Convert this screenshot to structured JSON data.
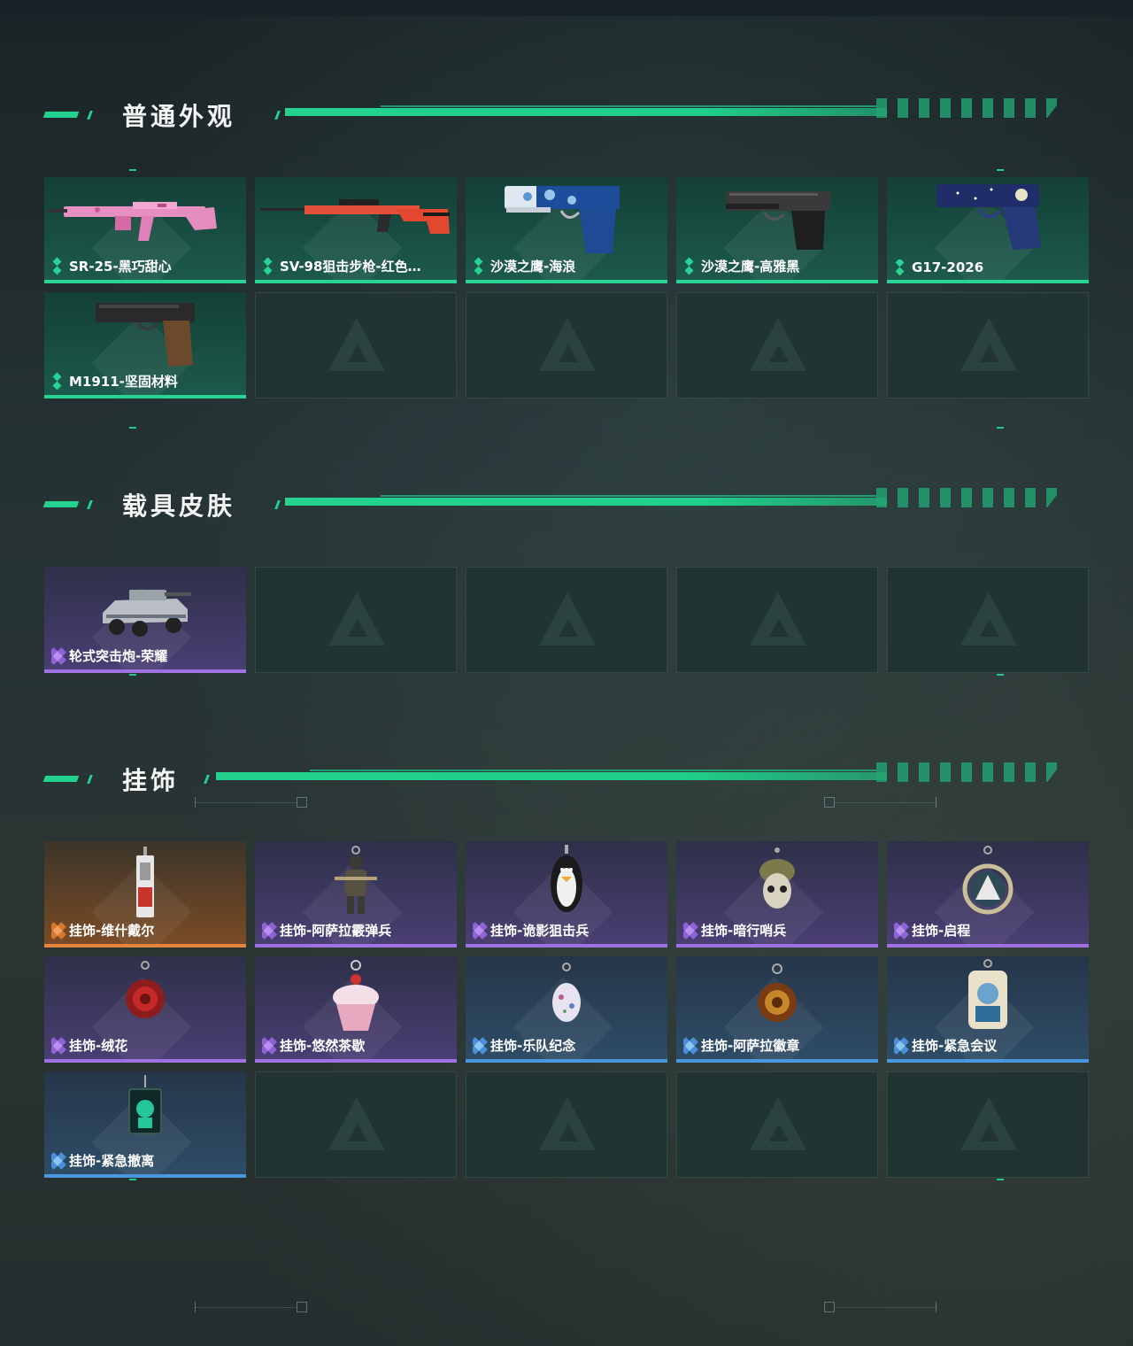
{
  "sections": {
    "weapons": {
      "title": "普通外观",
      "items": [
        {
          "label": "SR-25-黑巧甜心",
          "rarity": "green",
          "icon": "pink-camo-rifle"
        },
        {
          "label": "SV-98狙击步枪-红色…",
          "rarity": "green",
          "icon": "red-sniper-rifle"
        },
        {
          "label": "沙漠之鹰-海浪",
          "rarity": "green",
          "icon": "blue-wave-pistol"
        },
        {
          "label": "沙漠之鹰-高雅黑",
          "rarity": "green",
          "icon": "black-pistol"
        },
        {
          "label": "G17-2026",
          "rarity": "green",
          "icon": "navy-pistol"
        },
        {
          "label": "M1911-坚固材料",
          "rarity": "green",
          "icon": "m1911-pistol"
        }
      ]
    },
    "vehicles": {
      "title": "载具皮肤",
      "items": [
        {
          "label": "轮式突击炮-荣耀",
          "rarity": "purple",
          "icon": "armored-vehicle"
        }
      ]
    },
    "charms": {
      "title": "挂饰",
      "items": [
        {
          "label": "挂饰-维什戴尔",
          "rarity": "orange",
          "icon": "tag-charm"
        },
        {
          "label": "挂饰-阿萨拉霰弹兵",
          "rarity": "purple",
          "icon": "soldier-charm"
        },
        {
          "label": "挂饰-诡影狙击兵",
          "rarity": "purple",
          "icon": "penguin-charm"
        },
        {
          "label": "挂饰-暗行哨兵",
          "rarity": "purple",
          "icon": "skull-charm"
        },
        {
          "label": "挂饰-启程",
          "rarity": "purple",
          "icon": "ring-charm"
        },
        {
          "label": "挂饰-绒花",
          "rarity": "purple",
          "icon": "rose-charm"
        },
        {
          "label": "挂饰-悠然茶歇",
          "rarity": "purple",
          "icon": "cupcake-charm"
        },
        {
          "label": "挂饰-乐队纪念",
          "rarity": "blue",
          "icon": "egg-charm"
        },
        {
          "label": "挂饰-阿萨拉徽章",
          "rarity": "blue",
          "icon": "badge-charm"
        },
        {
          "label": "挂饰-紧急会议",
          "rarity": "blue",
          "icon": "acrylic-charm"
        },
        {
          "label": "挂饰-紧急撤离",
          "rarity": "blue",
          "icon": "cube-charm"
        }
      ]
    }
  },
  "colors": {
    "accent": "#23d28e",
    "green": "#28d394",
    "purple": "#a071e2",
    "orange": "#e0853b",
    "blue": "#4a97e0"
  }
}
